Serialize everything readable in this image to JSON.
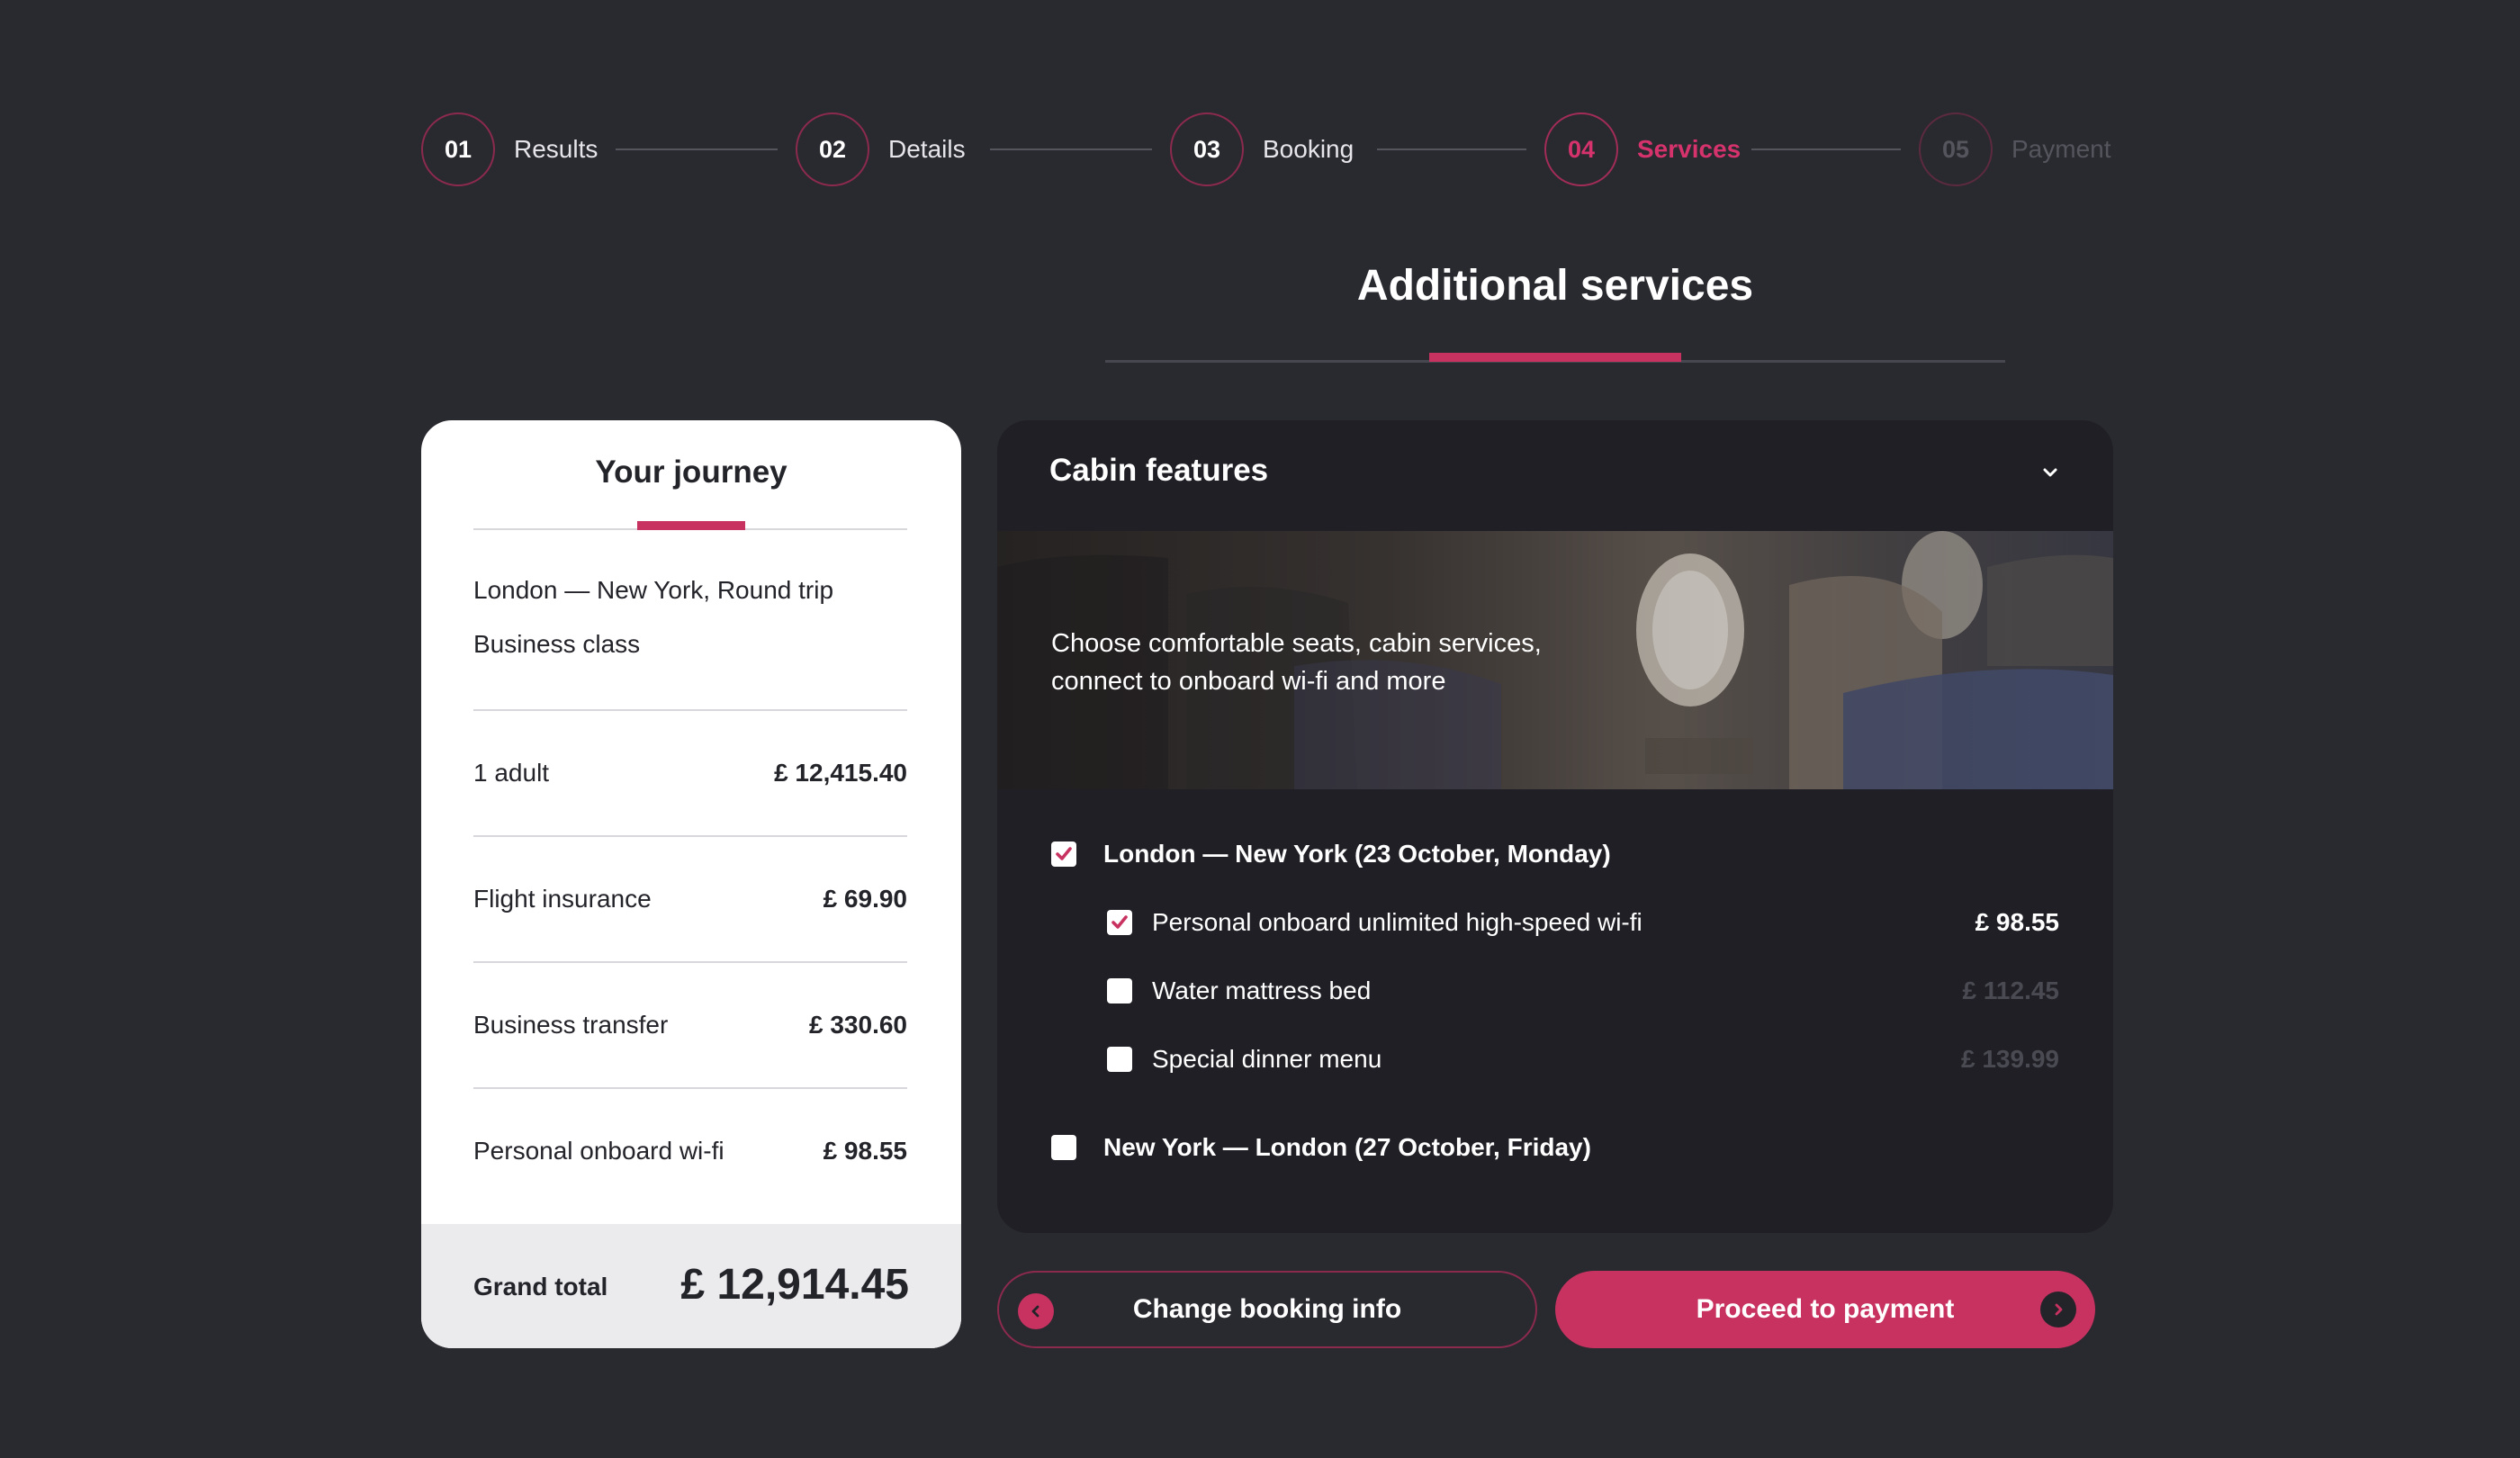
{
  "colors": {
    "accent": "#c83260",
    "background": "#292930",
    "panel": "#1f1f25",
    "card": "#ffffff"
  },
  "stepper": {
    "steps": [
      {
        "number": "01",
        "label": "Results",
        "state": "done"
      },
      {
        "number": "02",
        "label": "Details",
        "state": "done"
      },
      {
        "number": "03",
        "label": "Booking",
        "state": "done"
      },
      {
        "number": "04",
        "label": "Services",
        "state": "active"
      },
      {
        "number": "05",
        "label": "Payment",
        "state": "upcoming"
      }
    ]
  },
  "page": {
    "title": "Additional services"
  },
  "journey": {
    "title": "Your journey",
    "route": "London — New York, Round trip",
    "class": "Business class",
    "items": [
      {
        "label": "1 adult",
        "price": "£ 12,415.40"
      },
      {
        "label": "Flight insurance",
        "price": "£ 69.90"
      },
      {
        "label": "Business transfer",
        "price": "£ 330.60"
      },
      {
        "label": "Personal onboard wi-fi",
        "price": "£ 98.55"
      }
    ],
    "grand_total_label": "Grand total",
    "grand_total_value": "£ 12,914.45"
  },
  "cabin": {
    "title": "Cabin features",
    "toggle_icon": "chevron-down-icon",
    "hero_text": "Choose comfortable seats, cabin services, connect to onboard wi-fi and more",
    "flights": [
      {
        "label": "London — New York (23 October, Monday)",
        "checked": true,
        "options": [
          {
            "label": "Personal onboard unlimited high-speed wi-fi",
            "price": "£ 98.55",
            "checked": true
          },
          {
            "label": "Water mattress bed",
            "price": "£ 112.45",
            "checked": false
          },
          {
            "label": "Special dinner menu",
            "price": "£ 139.99",
            "checked": false
          }
        ]
      },
      {
        "label": "New York — London (27 October, Friday)",
        "checked": false
      }
    ]
  },
  "actions": {
    "back_label": "Change booking info",
    "back_icon": "chevron-left-icon",
    "next_label": "Proceed to payment",
    "next_icon": "chevron-right-icon"
  }
}
